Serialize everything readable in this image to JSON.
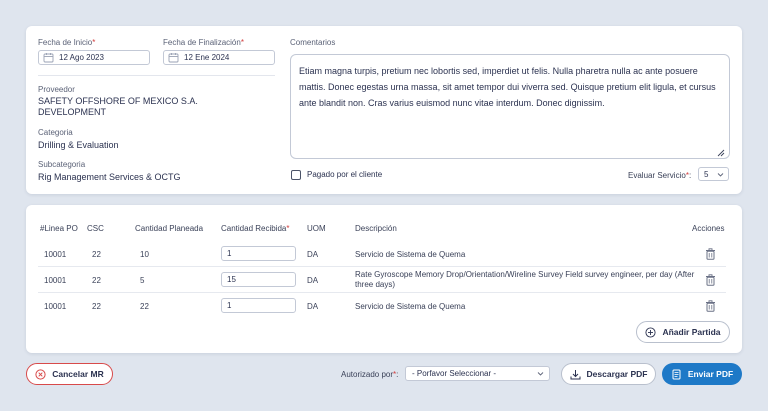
{
  "form": {
    "start_date_label": "Fecha de Inicio",
    "start_date_value": "12 Ago  2023",
    "end_date_label": "Fecha de Finalización",
    "end_date_value": "12 Ene  2024",
    "required_mark": "*",
    "provider_label": "Proveedor",
    "provider_line1": "SAFETY OFFSHORE OF MEXICO S.A.",
    "provider_line2": "DEVELOPMENT",
    "category_label": "Categoria",
    "category_value": "Drilling & Evaluation",
    "subcategory_label": "Subcategoria",
    "subcategory_value": "Rig Management Services & OCTG",
    "comments_label": "Comentarios",
    "comments_text": "Etiam magna turpis, pretium nec lobortis sed, imperdiet ut felis. Nulla pharetra nulla ac ante posuere mattis. Donec egestas urna massa, sit amet tempor dui viverra sed. Quisque pretium elit ligula, et cursus ante blandit non. Cras varius euismod nunc vitae interdum. Donec dignissim.",
    "paid_by_client_label": "Pagado por el cliente",
    "paid_by_client_checked": false,
    "evaluate_label": "Evaluar Servicio",
    "evaluate_suffix": ":",
    "evaluate_value": "5"
  },
  "table": {
    "headers": {
      "line": "#Linea PO",
      "csc": "CSC",
      "planned": "Cantidad Planeada",
      "received": "Cantidad Recibida",
      "uom": "UOM",
      "description": "Descripción",
      "actions": "Acciones"
    },
    "rows": [
      {
        "line": "10001",
        "csc": "22",
        "planned": "10",
        "received": "1",
        "uom": "DA",
        "description": "Servicio de Sistema de Quema"
      },
      {
        "line": "10001",
        "csc": "22",
        "planned": "5",
        "received": "15",
        "uom": "DA",
        "description": "Rate Gyroscope Memory Drop/Orientation/Wireline Survey Field survey engineer, per day (After three days)"
      },
      {
        "line": "10001",
        "csc": "22",
        "planned": "22",
        "received": "1",
        "uom": "DA",
        "description": "Servicio de Sistema de Quema"
      }
    ],
    "add_item_label": "Añadir Partida"
  },
  "footer": {
    "cancel_label": "Cancelar MR",
    "authorized_label": "Autorizado por",
    "authorized_placeholder": "- Porfavor Seleccionar -",
    "download_label": "Descargar PDF",
    "send_label": "Enviar PDF"
  },
  "colors": {
    "background": "#dfe5ee",
    "primary": "#1e79c7",
    "danger": "#d84a4a",
    "required": "#d23b3b"
  }
}
